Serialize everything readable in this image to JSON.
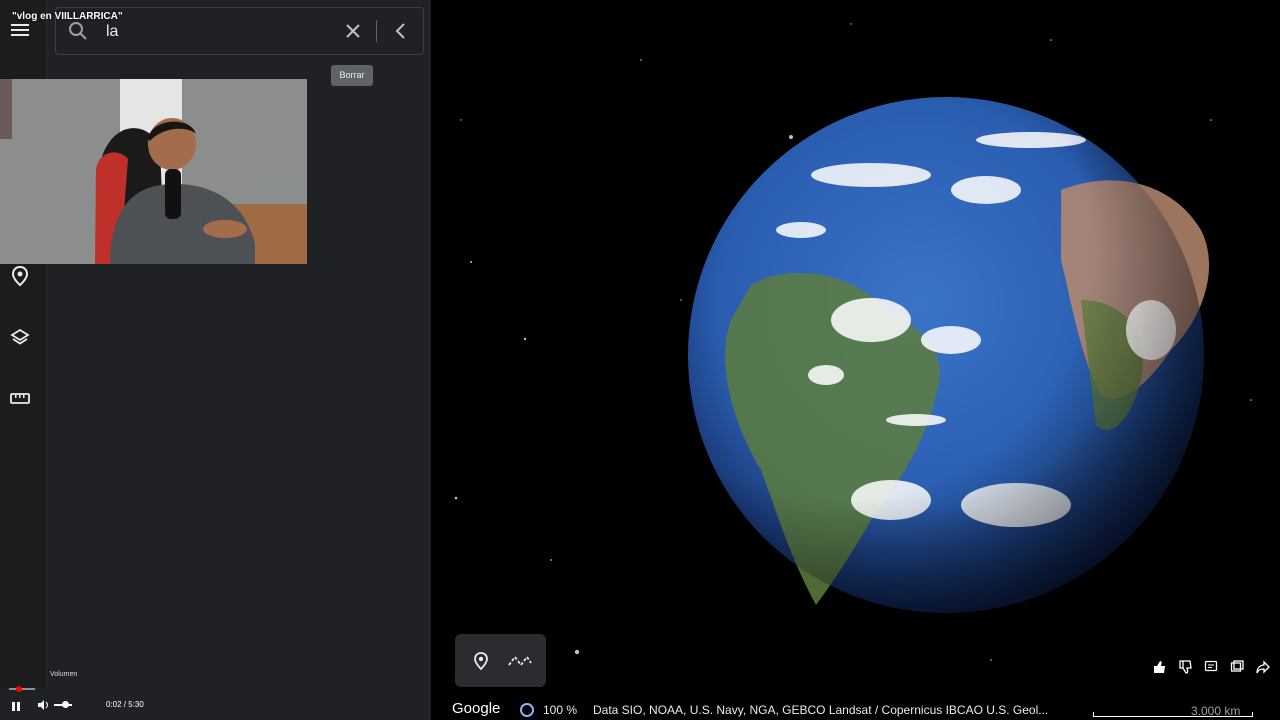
{
  "video": {
    "title": "\"vlog en VIILLARRICA\"",
    "time": "0:02 / 5:30",
    "volume_tooltip": "Volumen"
  },
  "search": {
    "value": "la",
    "clear_tooltip": "Borrar"
  },
  "rail": {
    "icons": [
      "menu-icon",
      "place-icon",
      "layers-icon",
      "ruler-icon"
    ]
  },
  "map_footer": {
    "logo": "Google",
    "zoom": "100 %",
    "attribution": "Data SIO, NOAA, U.S. Navy, NGA, GEBCO   Landsat / Copernicus   IBCAO   U.S. Geol...",
    "scale": "3.000 km"
  },
  "colors": {
    "panel": "#202124",
    "accent_blue": "#8ab4f8",
    "space": "#000000"
  }
}
